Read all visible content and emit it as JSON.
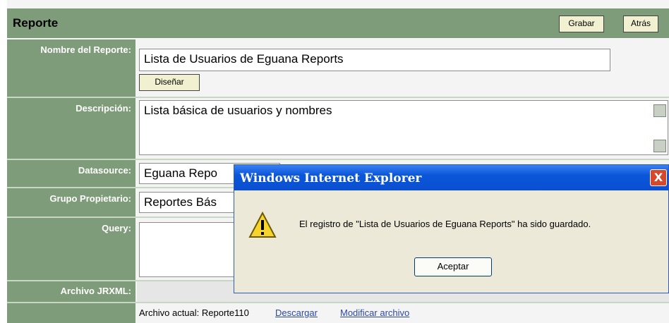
{
  "header": {
    "title": "Reporte",
    "save_label": "Grabar",
    "back_label": "Atrás"
  },
  "fields": {
    "report_name_label": "Nombre del Reporte:",
    "report_name_value": "Lista de Usuarios de Eguana Reports",
    "design_label": "Diseñar",
    "description_label": "Descripción:",
    "description_value": "Lista básica de usuarios y nombres",
    "datasource_label": "Datasource:",
    "datasource_value": "Eguana Repo",
    "owner_group_label": "Grupo Propietario:",
    "owner_group_value": "Reportes Bás",
    "query_label": "Query:",
    "jrxml_label": "Archivo JRXML:",
    "current_file_text": "Archivo actual: Reporte110",
    "download_link": "Descargar",
    "modify_link": "Modificar archivo"
  },
  "dialog": {
    "title": "Windows Internet Explorer",
    "close_symbol": "X",
    "message": "El registro de \"Lista de Usuarios de Eguana Reports\" ha sido guardado.",
    "ok_label": "Aceptar",
    "icon": "warning-icon"
  },
  "colors": {
    "label_bg": "#7f9c7a",
    "dialog_title": "#0a56d9",
    "warning": "#f6d32d"
  }
}
